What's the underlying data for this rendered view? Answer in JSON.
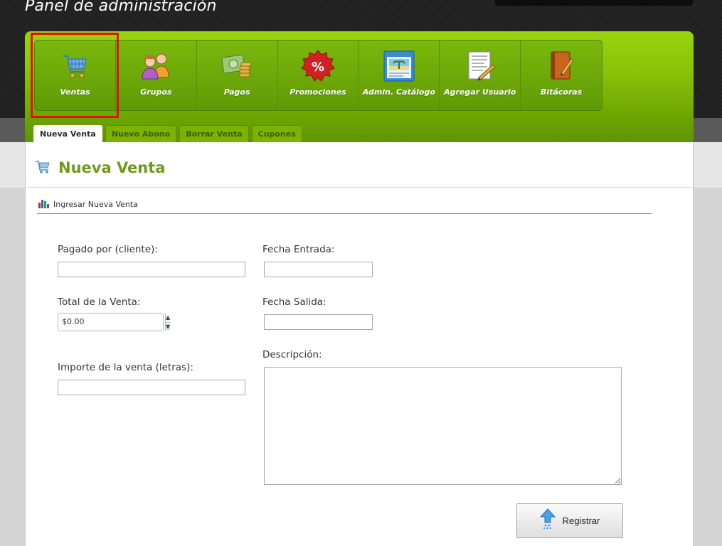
{
  "app": {
    "title": "Panel de administración"
  },
  "menu": {
    "items": [
      {
        "label": "Ventas",
        "icon": "shopping-cart-icon",
        "selected": true
      },
      {
        "label": "Grupos",
        "icon": "users-group-icon"
      },
      {
        "label": "Pagos",
        "icon": "money-coins-icon"
      },
      {
        "label": "Promociones",
        "icon": "percent-badge-icon"
      },
      {
        "label": "Admin. Catálogo",
        "icon": "catalog-window-icon"
      },
      {
        "label": "Agregar Usuario",
        "icon": "document-pencil-icon"
      },
      {
        "label": "Bitácoras",
        "icon": "notebook-pencil-icon"
      }
    ]
  },
  "subtabs": [
    {
      "label": "Nueva Venta",
      "active": true
    },
    {
      "label": "Nuevo Abono"
    },
    {
      "label": "Borrar Venta"
    },
    {
      "label": "Cupones"
    }
  ],
  "page": {
    "title": "Nueva Venta",
    "section_label": "Ingresar Nueva Venta"
  },
  "form": {
    "pagado_por_label": "Pagado por (cliente):",
    "pagado_por_value": "",
    "total_label": "Total de la Venta:",
    "total_value": "$0.00",
    "importe_label": "Importe de la venta (letras):",
    "importe_value": "",
    "fecha_entrada_label": "Fecha Entrada:",
    "fecha_entrada_value": "",
    "fecha_salida_label": "Fecha Salida:",
    "fecha_salida_value": "",
    "descripcion_label": "Descripción:",
    "descripcion_value": "",
    "submit_label": "Registrar"
  },
  "colors": {
    "brand_green": "#86c107",
    "title_green": "#6d9a1b",
    "selection_red": "#e01010"
  }
}
